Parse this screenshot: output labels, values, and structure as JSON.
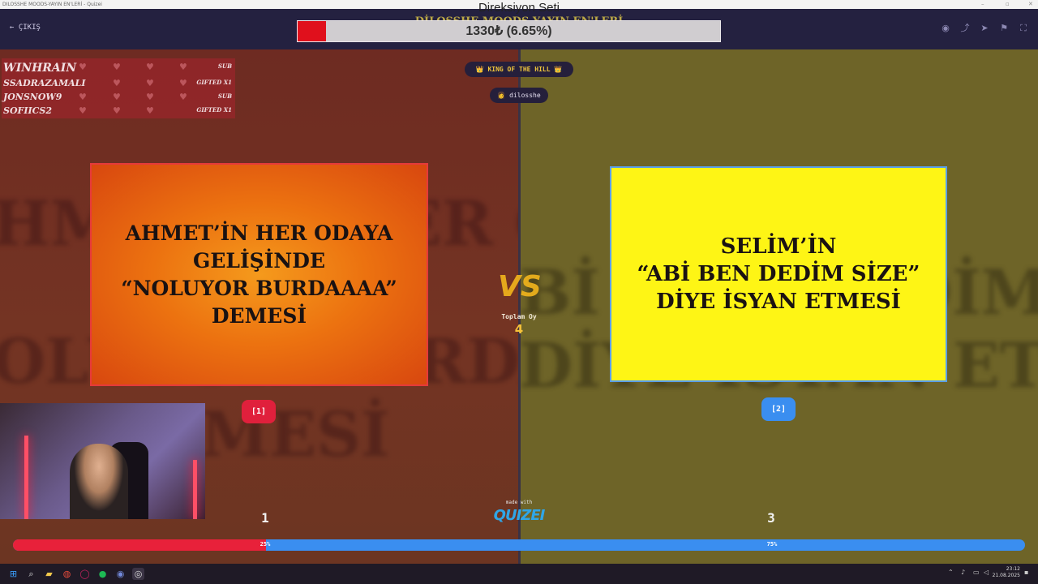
{
  "window": {
    "title": "DILOSSHE MOODS-YAYIN EN'LERİ - Quizei"
  },
  "header": {
    "exit_label": "ÇIKIŞ",
    "goal_title": "Direksiyon Seti",
    "ghost_subtitle": "DİLOSSHE MOODS-YAYIN EN'LERİ",
    "goal_text": "1330₺ (6.65%)",
    "goal_progress": 0.0665,
    "icons": [
      "eye-icon",
      "share-icon",
      "send-icon",
      "flag-icon",
      "fullscreen-icon"
    ]
  },
  "subs": [
    {
      "name": "WINHRAIN",
      "tag": "SUB"
    },
    {
      "name": "SSADRAZAMALI",
      "tag": "GIFTED X1"
    },
    {
      "name": "JONSNOW9",
      "tag": "SUB"
    },
    {
      "name": "SOFIICS2",
      "tag": "GIFTED X1"
    }
  ],
  "badges": {
    "king": "👑 KING OF THE HILL 👑",
    "streamer": "👩 dilosshe"
  },
  "cards": {
    "option1": "AHMET’İN HER ODAYA\nGELİŞİNDE\n“NOLUYOR BURDAAAA”\nDEMESİ",
    "option2": "SELİM’İN\n“ABİ BEN DEDİM SİZE”\nDİYE İSYAN ETMESİ",
    "pick1": "[1]",
    "pick2": "[2]"
  },
  "center": {
    "vs": "VS",
    "total_label": "Toplam Oy",
    "total_value": "4",
    "made_with": "made with",
    "brand": "QUIZEI"
  },
  "votes": {
    "count1": "1",
    "count2": "3",
    "pct1": "25%",
    "pct2": "75%",
    "share1": 0.25
  },
  "taskbar": {
    "time": "23:12",
    "date": "21.08.2025"
  },
  "colors": {
    "red": "#e8213a",
    "blue": "#3a8ef0",
    "gold": "#f2b51c"
  }
}
